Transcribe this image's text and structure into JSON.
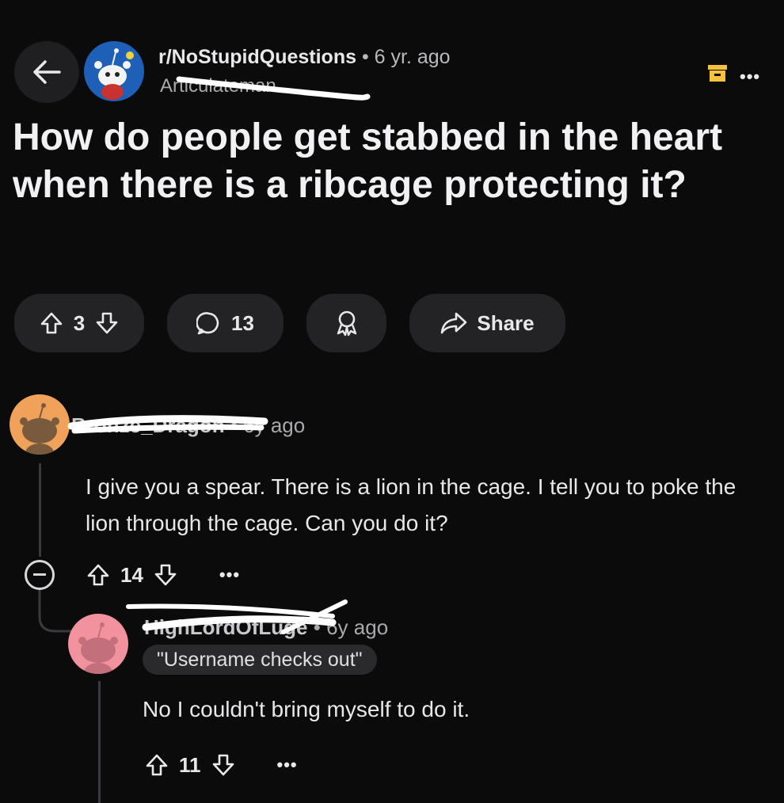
{
  "post": {
    "subreddit": "r/NoStupidQuestions",
    "separator": "•",
    "age": "6 yr. ago",
    "author": "Articulateman",
    "title": "How do people get stabbed in the heart when there is a ribcage protecting it?",
    "score": "3",
    "comment_count": "13",
    "share_label": "Share"
  },
  "comments": [
    {
      "author": "Bronze_Dragon",
      "separator": "•",
      "age": "6y ago",
      "text": "I give you a spear. There is a lion in the cage. I tell you to poke the lion through the cage. Can you do it?",
      "score": "14",
      "more": "•••"
    },
    {
      "author": "HighLordOfLuge",
      "separator": "•",
      "age": "6y ago",
      "flair": "\"Username checks out\"",
      "text": "No I couldn't bring myself to do it.",
      "score": "11",
      "more": "•••"
    }
  ],
  "toolbar": {
    "more": "•••"
  },
  "colors": {
    "background": "#0b0b0c",
    "pill": "#232326",
    "subreddit_avatar": "#1e5fb8",
    "archive_icon": "#f4c23d",
    "commenter1_avatar": "#f0a25a",
    "commenter2_avatar": "#f2929f"
  },
  "icons": [
    "back-arrow-icon",
    "archive-icon",
    "more-icon",
    "upvote-icon",
    "downvote-icon",
    "comment-icon",
    "award-icon",
    "share-icon",
    "collapse-icon",
    "snoo-avatar-icon"
  ]
}
